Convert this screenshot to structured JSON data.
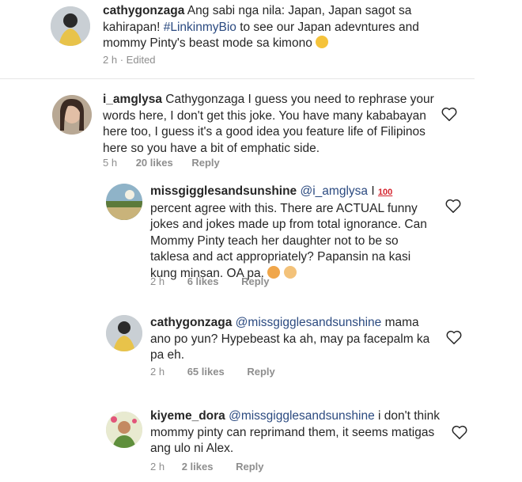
{
  "comments": [
    {
      "username": "cathygonzaga",
      "text_before": " Ang sabi nga nila: Japan, Japan sagot sa kahirapan! ",
      "hashtag": "#LinkinmyBio",
      "text_after": " to see our Japan adevntures and mommy Pinty's beast mode sa kimono",
      "time": "2 h",
      "edited": "Edited"
    },
    {
      "username": "i_amglysa",
      "text": " Cathygonzaga I guess you need to rephrase your words here, I don't get this joke. You have many kababayan here too, I guess  it's a good idea you feature life of Filipinos here so you have a bit of emphatic side.",
      "time": "5 h",
      "likes": "20 likes",
      "reply": "Reply"
    },
    {
      "username": "missgigglesandsunshine",
      "mention": "@i_amglysa",
      "text_pre": " I ",
      "hundred": "100",
      "text": " percent agree with this. There are ACTUAL funny jokes and jokes made up from total ignorance. Can Mommy Pinty teach her daughter not to be so taklesa and act appropriately? Papansin na kasi kung minsan. OA pa.",
      "time": "2 h",
      "likes": "6 likes",
      "reply": "Reply"
    },
    {
      "username": "cathygonzaga",
      "mention": "@missgigglesandsunshine",
      "text": " mama ano po yun? Hypebeast ka ah, may pa facepalm ka pa eh.",
      "time": "2 h",
      "likes": "65 likes",
      "reply": "Reply"
    },
    {
      "username": "kiyeme_dora",
      "mention": "@missgigglesandsunshine",
      "text": " i don't think mommy pinty can reprimand them, it seems matigas ang ulo ni Alex.",
      "time": "2 h",
      "likes": "2 likes",
      "reply": "Reply"
    }
  ],
  "icons": {
    "heart": "heart-outline-icon",
    "laugh_emoji": "grinning-sweat-emoji",
    "facepalm_emoji": "facepalm-emoji",
    "hand_emoji": "fingers-crossed-emoji",
    "hundred_emoji": "hundred-points-emoji"
  },
  "colors": {
    "mention": "#2b4a80",
    "meta": "#8e8e8e",
    "text": "#262626"
  }
}
